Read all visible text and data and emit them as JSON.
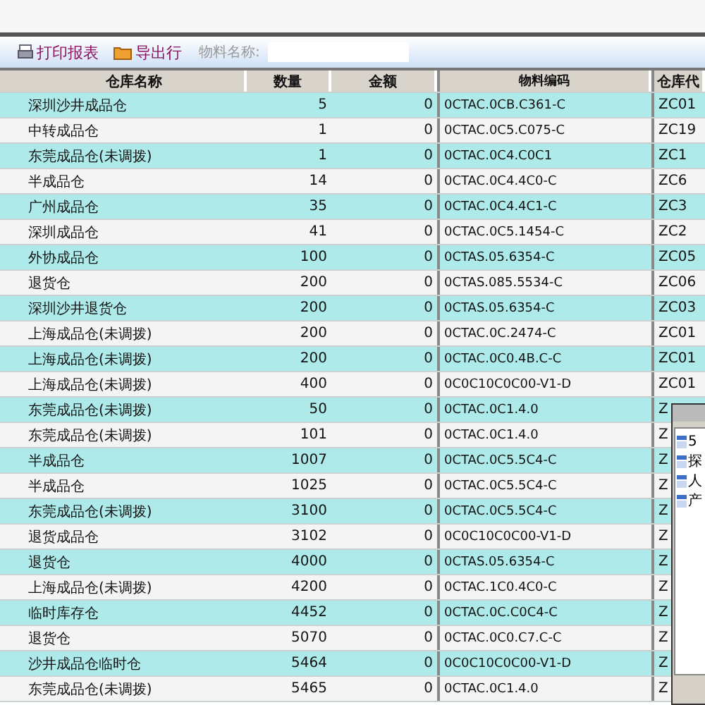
{
  "toolbar": {
    "buttons": [
      {
        "label": "打印报表",
        "kind": "print"
      },
      {
        "label": "导出行",
        "kind": "export"
      }
    ],
    "search": {
      "label": "物料名称:"
    }
  },
  "table": {
    "columns": [
      "仓库名称",
      "数量",
      "金额",
      "物料编码",
      "仓库代"
    ],
    "rows": [
      {
        "name": "深圳沙井成品仓",
        "qty": "5",
        "amount": "0",
        "code": "0CTAC.0CB.C361-C",
        "col5": "ZC01"
      },
      {
        "name": "中转成品仓",
        "qty": "1",
        "amount": "0",
        "code": "0CTAC.0C5.C075-C",
        "col5": "ZC19"
      },
      {
        "name": "东莞成品仓(未调拨)",
        "qty": "1",
        "amount": "0",
        "code": "0CTAC.0C4.C0C1",
        "col5": "ZC1"
      },
      {
        "name": "半成品仓",
        "qty": "14",
        "amount": "0",
        "code": "0CTAC.0C4.4C0-C",
        "col5": "ZC6"
      },
      {
        "name": "广州成品仓",
        "qty": "35",
        "amount": "0",
        "code": "0CTAC.0C4.4C1-C",
        "col5": "ZC3"
      },
      {
        "name": "深圳成品仓",
        "qty": "41",
        "amount": "0",
        "code": "0CTAC.0C5.1454-C",
        "col5": "ZC2"
      },
      {
        "name": "外协成品仓",
        "qty": "100",
        "amount": "0",
        "code": "0CTAS.05.6354-C",
        "col5": "ZC05"
      },
      {
        "name": "退货仓",
        "qty": "200",
        "amount": "0",
        "code": "0CTAS.085.5534-C",
        "col5": "ZC06"
      },
      {
        "name": "深圳沙井退货仓",
        "qty": "200",
        "amount": "0",
        "code": "0CTAS.05.6354-C",
        "col5": "ZC03"
      },
      {
        "name": "上海成品仓(未调拨)",
        "qty": "200",
        "amount": "0",
        "code": "0CTAC.0C.2474-C",
        "col5": "ZC01"
      },
      {
        "name": "上海成品仓(未调拨)",
        "qty": "200",
        "amount": "0",
        "code": "0CTAC.0C0.4B.C-C",
        "col5": "ZC01"
      },
      {
        "name": "上海成品仓(未调拨)",
        "qty": "400",
        "amount": "0",
        "code": "0C0C10C0C00-V1-D",
        "col5": "ZC01"
      },
      {
        "name": "东莞成品仓(未调拨)",
        "qty": "50",
        "amount": "0",
        "code": "0CTAC.0C1.4.0",
        "col5": "Z"
      },
      {
        "name": "东莞成品仓(未调拨)",
        "qty": "101",
        "amount": "0",
        "code": "0CTAC.0C1.4.0",
        "col5": "Z"
      },
      {
        "name": "半成品仓",
        "qty": "1007",
        "amount": "0",
        "code": "0CTAC.0C5.5C4-C",
        "col5": "Z"
      },
      {
        "name": "半成品仓",
        "qty": "1025",
        "amount": "0",
        "code": "0CTAC.0C5.5C4-C",
        "col5": "Z"
      },
      {
        "name": "东莞成品仓(未调拨)",
        "qty": "3100",
        "amount": "0",
        "code": "0CTAC.0C5.5C4-C",
        "col5": "Z"
      },
      {
        "name": "退货成品仓",
        "qty": "3102",
        "amount": "0",
        "code": "0C0C10C0C00-V1-D",
        "col5": "Z"
      },
      {
        "name": "退货仓",
        "qty": "4000",
        "amount": "0",
        "code": "0CTAS.05.6354-C",
        "col5": "Z"
      },
      {
        "name": "上海成品仓(未调拨)",
        "qty": "4200",
        "amount": "0",
        "code": "0CTAC.1C0.4C0-C",
        "col5": "Z"
      },
      {
        "name": "临时库存仓",
        "qty": "4452",
        "amount": "0",
        "code": "0CTAC.0C.C0C4-C",
        "col5": "Z"
      },
      {
        "name": "退货仓",
        "qty": "5070",
        "amount": "0",
        "code": "0CTAC.0C0.C7.C-C",
        "col5": "Z"
      },
      {
        "name": "沙井成品仓临时仓",
        "qty": "5464",
        "amount": "0",
        "code": "0C0C10C0C00-V1-D",
        "col5": "Z"
      },
      {
        "name": "东莞成品仓(未调拨)",
        "qty": "5465",
        "amount": "0",
        "code": "0CTAC.0C1.4.0",
        "col5": "Z"
      }
    ]
  },
  "popup": {
    "items": [
      {
        "label": "5"
      },
      {
        "label": "探"
      },
      {
        "label": "人"
      },
      {
        "label": "产"
      }
    ]
  }
}
